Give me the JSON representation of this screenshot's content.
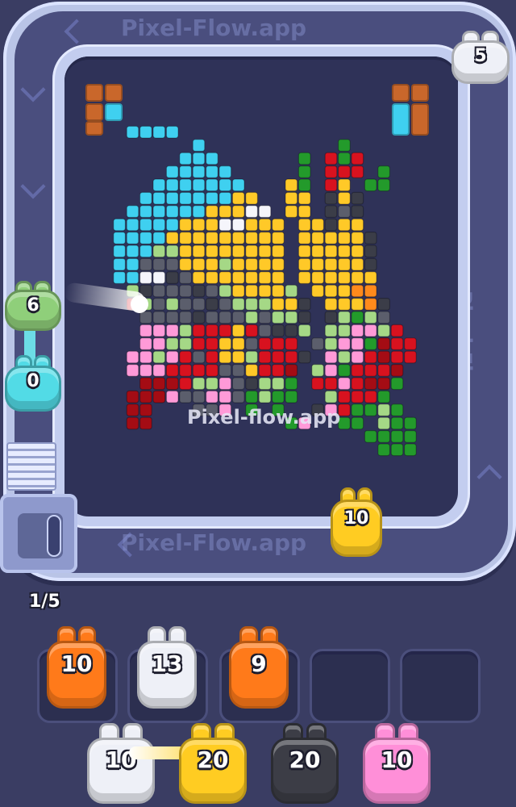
{
  "level_progress": "1/5",
  "watermarks": {
    "top": "Pixel-Flow.app",
    "bottom": "Pixel-Flow.app",
    "side": "Pixel-Flow.app",
    "center": "Pixel-flow.app"
  },
  "colors": {
    "background": "#3a3d63",
    "board": "#2f3258",
    "track": "#b9c4e6",
    "cyan": "#3fd0f0",
    "yellow": "#ffc928",
    "orange": "#ff8a1c",
    "white": "#f5f5fb",
    "gray": "#5b5e6c",
    "darkgray": "#3b3d48",
    "red": "#d8121f",
    "darkred": "#a40c14",
    "green": "#239a2b",
    "lightgreen": "#a5d886",
    "pink": "#ff9ad8",
    "brown": "#c9672b",
    "shooter_orange": "#ff7a1a",
    "shooter_white": "#eef0f7",
    "shooter_yellow": "#ffcc22",
    "shooter_black": "#3c3d46",
    "shooter_pink": "#ff8fd8",
    "shooter_green": "#8fcf7a",
    "shooter_cyan": "#52dbe6"
  },
  "conveyor_shooters": [
    {
      "id": "green",
      "count": "6",
      "color": "shooter_green"
    },
    {
      "id": "cyan",
      "count": "0",
      "color": "shooter_cyan"
    },
    {
      "id": "white",
      "count": "5",
      "color": "shooter_white"
    },
    {
      "id": "yellow",
      "count": "10",
      "color": "shooter_yellow"
    }
  ],
  "queue_slots": [
    {
      "count": "10",
      "color": "shooter_orange"
    },
    {
      "count": "13",
      "color": "shooter_white"
    },
    {
      "count": "9",
      "color": "shooter_orange"
    },
    {
      "count": "",
      "color": ""
    },
    {
      "count": "",
      "color": ""
    }
  ],
  "reserve": [
    {
      "count": "10",
      "color": "shooter_white"
    },
    {
      "count": "20",
      "color": "shooter_yellow"
    },
    {
      "count": "20",
      "color": "shooter_black"
    },
    {
      "count": "10",
      "color": "shooter_pink"
    }
  ],
  "pixel_art": {
    "legend": {
      "c": "cyan",
      "y": "yellow",
      "o": "orange",
      "w": "white",
      "g": "gray",
      "k": "darkgray",
      "r": "red",
      "d": "darkred",
      "G": "green",
      "l": "lightgreen",
      "p": "pink",
      "b": "brown"
    },
    "rows": [
      ".........................",
      "...cccc..................",
      "........c..........G.....",
      ".......ccc......G.rGr....",
      "......ccccc.....G.rrr.G..",
      ".....ccccccc...yG.ry.GG..",
      "....cccccccyy..yy.kyk....",
      "...ccccccyyyww.yy.kgk....",
      "..cccccyyywwyyy.yykyy....",
      "..ccccyyyyyyyyy.yyyyyk...",
      "..cccllyyyyyyyy.yyyyyk...",
      "..ccgggyyylyyyy.yyyyyk...",
      "..ccwwkgyyyyyyy.yyyyyy...",
      "...lkgggkglyyyyl.yyyoo...",
      "...rlglggkglllyyk.yyyok..",
      "....ggggkggglgllk.klGlg..",
      "....ppplrrryrgkkl.llpplr.",
      "....ppllrryygrrr.glppGdrr",
      "...pplprgryylrrrk.plprdrr",
      "...ppprrrrggyrrd.lpGrrrd.",
      "....dddrllpgkllG.rrprddG.",
      "...dddpggppgGlGG..lrrrG..",
      "...dd...ggp.G.G..kprGGlG.",
      "...dd..........Gp..GG.lGG",
      ".....................GGGG",
      "......................GGG"
    ]
  }
}
